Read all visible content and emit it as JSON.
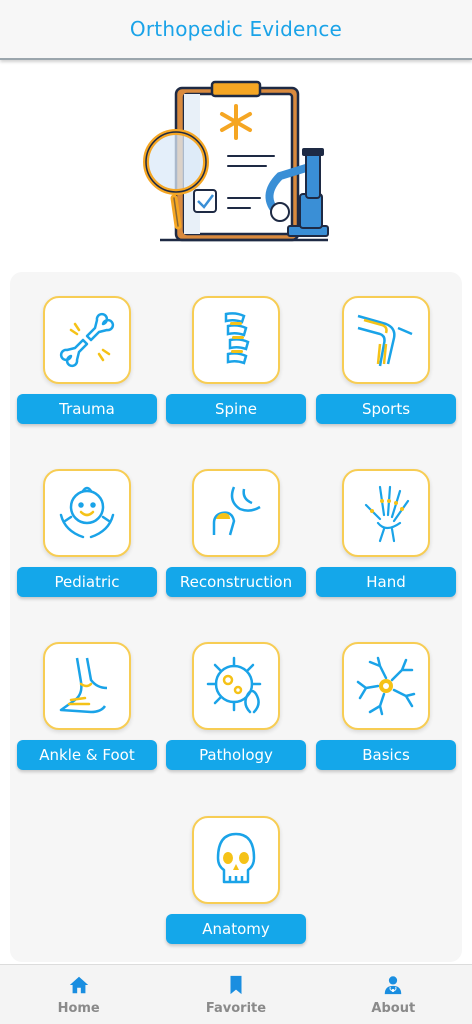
{
  "app": {
    "title": "Orthopedic Evidence"
  },
  "colors": {
    "accent": "#14a7ea",
    "tile_border": "#f7cd54",
    "icon_yellow": "#f5c217",
    "nav_active": "#1a8ee0"
  },
  "categories": [
    {
      "label": "Trauma",
      "icon": "broken-bone-icon"
    },
    {
      "label": "Spine",
      "icon": "spine-icon"
    },
    {
      "label": "Sports",
      "icon": "knee-joint-icon"
    },
    {
      "label": "Pediatric",
      "icon": "baby-face-icon"
    },
    {
      "label": "Reconstruction",
      "icon": "hip-joint-icon"
    },
    {
      "label": "Hand",
      "icon": "hand-bones-icon"
    },
    {
      "label": "Ankle & Foot",
      "icon": "foot-bones-icon"
    },
    {
      "label": "Pathology",
      "icon": "virus-ribbon-icon"
    },
    {
      "label": "Basics",
      "icon": "neuron-icon"
    },
    {
      "label": "Anatomy",
      "icon": "skull-icon"
    }
  ],
  "nav": [
    {
      "label": "Home",
      "icon": "home-icon"
    },
    {
      "label": "Favorite",
      "icon": "bookmark-icon"
    },
    {
      "label": "About",
      "icon": "doctor-icon"
    }
  ]
}
